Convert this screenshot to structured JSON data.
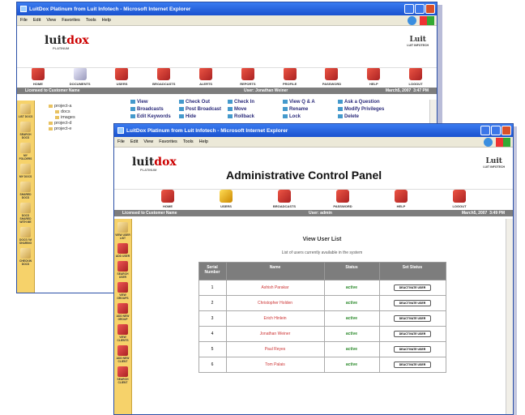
{
  "back_window": {
    "title": "LuitDox Platinum from Luit Infotech - Microsoft Internet Explorer",
    "menu": [
      "File",
      "Edit",
      "View",
      "Favorites",
      "Tools",
      "Help"
    ],
    "logo": {
      "part1": "luit",
      "part2": "dox",
      "sub": "PLATINUM"
    },
    "company_logo": {
      "text": "Luit",
      "sub": "LUIT INFOTECH"
    },
    "nav": [
      {
        "label": "HOME",
        "icon": "home-icon"
      },
      {
        "label": "DOCUMENTS",
        "icon": "documents-icon"
      },
      {
        "label": "USERS",
        "icon": "users-icon"
      },
      {
        "label": "BROADCASTS",
        "icon": "broadcasts-icon"
      },
      {
        "label": "ALERTS",
        "icon": "alerts-icon"
      },
      {
        "label": "REPORTS",
        "icon": "reports-icon"
      },
      {
        "label": "PROFILE",
        "icon": "profile-icon"
      },
      {
        "label": "PASSWORD",
        "icon": "password-icon"
      },
      {
        "label": "HELP",
        "icon": "help-icon"
      },
      {
        "label": "LOGOUT",
        "icon": "logout-icon"
      }
    ],
    "status": {
      "licensed": "Licensed to Customer Name",
      "user": "User: Jonathan Weiner",
      "date": "March5, 2007",
      "time": "3:47 PM"
    },
    "sidebar": [
      "LIST DOCS",
      "SEARCH DOCS",
      "MY FOLDERS",
      "MY DOCS",
      "SHARED DOCS",
      "DOCS SHARED WITH ME",
      "DOCS I'M SHARING",
      "CHECKIN DOCS"
    ],
    "tree": [
      {
        "label": "project-a",
        "sub": false
      },
      {
        "label": "docs",
        "sub": true
      },
      {
        "label": "images",
        "sub": true
      },
      {
        "label": "project-d",
        "sub": false
      },
      {
        "label": "project-e",
        "sub": false
      }
    ],
    "actions": [
      "View",
      "Check Out",
      "Check In",
      "View Q & A",
      "Ask a Question",
      "Broadcasts",
      "Post Broadcast",
      "Move",
      "Rename",
      "Modify Privileges",
      "Edit Keywords",
      "Hide",
      "Rollback",
      "Lock",
      "Delete"
    ]
  },
  "front_window": {
    "title": "LuitDox Platinum from Luit Infotech - Microsoft Internet Explorer",
    "menu": [
      "File",
      "Edit",
      "View",
      "Favorites",
      "Tools",
      "Help"
    ],
    "logo": {
      "part1": "luit",
      "part2": "dox",
      "sub": "PLATINUM"
    },
    "heading": "Administrative Control Panel",
    "company_logo": {
      "text": "Luit",
      "sub": "LUIT INFOTECH"
    },
    "nav": [
      {
        "label": "HOME",
        "icon": "home-icon"
      },
      {
        "label": "USERS",
        "icon": "users-icon"
      },
      {
        "label": "BROADCASTS",
        "icon": "broadcasts-icon"
      },
      {
        "label": "PASSWORD",
        "icon": "password-icon"
      },
      {
        "label": "HELP",
        "icon": "help-icon"
      },
      {
        "label": "LOGOUT",
        "icon": "logout-icon"
      }
    ],
    "status": {
      "licensed": "Licensed to Customer Name",
      "user": "User: admin",
      "date": "March5, 2007",
      "time": "3:49 PM"
    },
    "sidebar": [
      "VIEW USER LIST",
      "ADD USER",
      "SEARCH USER",
      "VIEW GROUPS",
      "ADD NEW GROUP",
      "VIEW CLIENTS",
      "ADD NEW CLIENT",
      "SEARCH CLIENT"
    ],
    "page_title": "View User List",
    "page_subtitle": "List of users currently available in the system",
    "table": {
      "headers": [
        "Serial Number",
        "Name",
        "Status",
        "Set Status"
      ],
      "rows": [
        {
          "serial": "1",
          "name": "Ashish Parakar",
          "status": "active",
          "action": "DEACTIVATE USER"
        },
        {
          "serial": "2",
          "name": "Christopher Holden",
          "status": "active",
          "action": "DEACTIVATE USER"
        },
        {
          "serial": "3",
          "name": "Erich Hinlein",
          "status": "active",
          "action": "DEACTIVATE USER"
        },
        {
          "serial": "4",
          "name": "Jonathan Weiner",
          "status": "active",
          "action": "DEACTIVATE USER"
        },
        {
          "serial": "5",
          "name": "Paul Reyes",
          "status": "active",
          "action": "DEACTIVATE USER"
        },
        {
          "serial": "6",
          "name": "Tom Palais",
          "status": "active",
          "action": "DEACTIVATE USER"
        }
      ]
    }
  }
}
